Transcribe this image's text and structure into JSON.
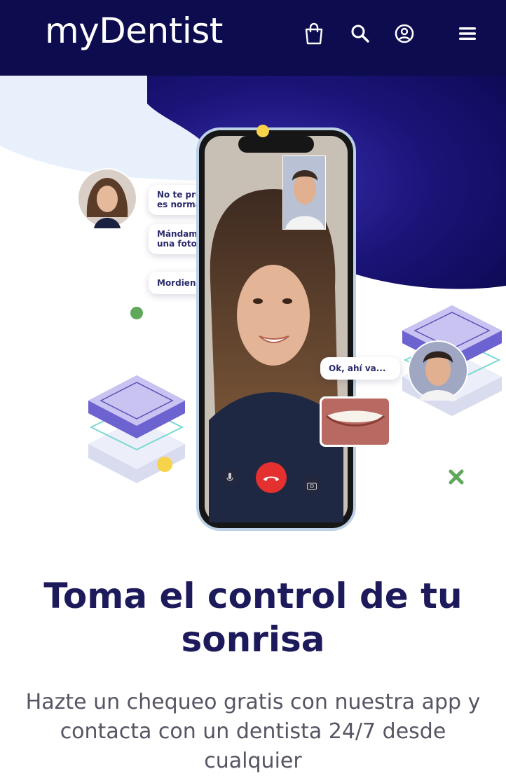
{
  "header": {
    "logo": "myDentist",
    "icons": [
      "shopping-bag-icon",
      "search-icon",
      "account-icon",
      "menu-icon"
    ]
  },
  "hero": {
    "bubbles": {
      "b1": "No te preocupes, es normal",
      "b2": "Mándame una foto",
      "b3": "Mordiendo",
      "b4": "Ok, ahí va..."
    }
  },
  "main": {
    "title": "Toma el control de tu sonrisa",
    "subtitle": "Hazte un chequeo gratis con nuestra app y contacta con un dentista 24/7 desde cualquier"
  },
  "colors": {
    "navy": "#0c0c4e",
    "title": "#1d1a5c",
    "accent_yellow": "#f7d34a",
    "accent_green": "#5fa85a",
    "call_red": "#e53030"
  }
}
